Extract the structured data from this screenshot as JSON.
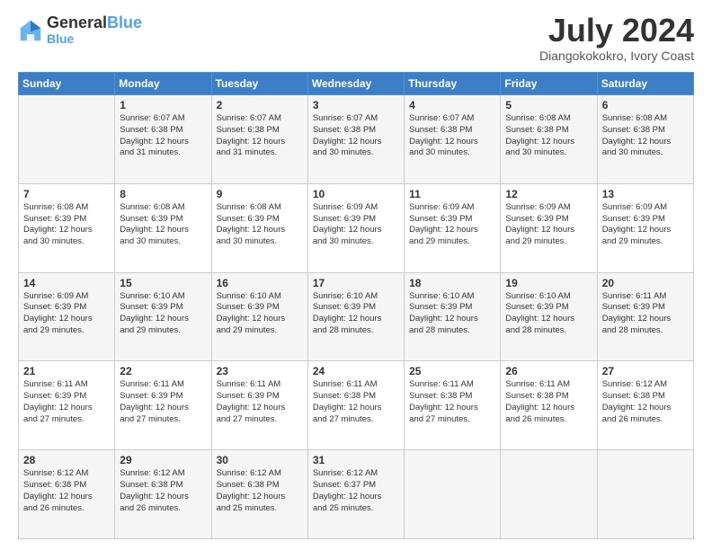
{
  "header": {
    "logo_line1": "General",
    "logo_line2": "Blue",
    "month_year": "July 2024",
    "location": "Diangokokokro, Ivory Coast"
  },
  "weekdays": [
    "Sunday",
    "Monday",
    "Tuesday",
    "Wednesday",
    "Thursday",
    "Friday",
    "Saturday"
  ],
  "weeks": [
    [
      {
        "day": "",
        "info": ""
      },
      {
        "day": "1",
        "info": "Sunrise: 6:07 AM\nSunset: 6:38 PM\nDaylight: 12 hours\nand 31 minutes."
      },
      {
        "day": "2",
        "info": "Sunrise: 6:07 AM\nSunset: 6:38 PM\nDaylight: 12 hours\nand 31 minutes."
      },
      {
        "day": "3",
        "info": "Sunrise: 6:07 AM\nSunset: 6:38 PM\nDaylight: 12 hours\nand 30 minutes."
      },
      {
        "day": "4",
        "info": "Sunrise: 6:07 AM\nSunset: 6:38 PM\nDaylight: 12 hours\nand 30 minutes."
      },
      {
        "day": "5",
        "info": "Sunrise: 6:08 AM\nSunset: 6:38 PM\nDaylight: 12 hours\nand 30 minutes."
      },
      {
        "day": "6",
        "info": "Sunrise: 6:08 AM\nSunset: 6:38 PM\nDaylight: 12 hours\nand 30 minutes."
      }
    ],
    [
      {
        "day": "7",
        "info": "Sunrise: 6:08 AM\nSunset: 6:39 PM\nDaylight: 12 hours\nand 30 minutes."
      },
      {
        "day": "8",
        "info": "Sunrise: 6:08 AM\nSunset: 6:39 PM\nDaylight: 12 hours\nand 30 minutes."
      },
      {
        "day": "9",
        "info": "Sunrise: 6:08 AM\nSunset: 6:39 PM\nDaylight: 12 hours\nand 30 minutes."
      },
      {
        "day": "10",
        "info": "Sunrise: 6:09 AM\nSunset: 6:39 PM\nDaylight: 12 hours\nand 30 minutes."
      },
      {
        "day": "11",
        "info": "Sunrise: 6:09 AM\nSunset: 6:39 PM\nDaylight: 12 hours\nand 29 minutes."
      },
      {
        "day": "12",
        "info": "Sunrise: 6:09 AM\nSunset: 6:39 PM\nDaylight: 12 hours\nand 29 minutes."
      },
      {
        "day": "13",
        "info": "Sunrise: 6:09 AM\nSunset: 6:39 PM\nDaylight: 12 hours\nand 29 minutes."
      }
    ],
    [
      {
        "day": "14",
        "info": "Sunrise: 6:09 AM\nSunset: 6:39 PM\nDaylight: 12 hours\nand 29 minutes."
      },
      {
        "day": "15",
        "info": "Sunrise: 6:10 AM\nSunset: 6:39 PM\nDaylight: 12 hours\nand 29 minutes."
      },
      {
        "day": "16",
        "info": "Sunrise: 6:10 AM\nSunset: 6:39 PM\nDaylight: 12 hours\nand 29 minutes."
      },
      {
        "day": "17",
        "info": "Sunrise: 6:10 AM\nSunset: 6:39 PM\nDaylight: 12 hours\nand 28 minutes."
      },
      {
        "day": "18",
        "info": "Sunrise: 6:10 AM\nSunset: 6:39 PM\nDaylight: 12 hours\nand 28 minutes."
      },
      {
        "day": "19",
        "info": "Sunrise: 6:10 AM\nSunset: 6:39 PM\nDaylight: 12 hours\nand 28 minutes."
      },
      {
        "day": "20",
        "info": "Sunrise: 6:11 AM\nSunset: 6:39 PM\nDaylight: 12 hours\nand 28 minutes."
      }
    ],
    [
      {
        "day": "21",
        "info": "Sunrise: 6:11 AM\nSunset: 6:39 PM\nDaylight: 12 hours\nand 27 minutes."
      },
      {
        "day": "22",
        "info": "Sunrise: 6:11 AM\nSunset: 6:39 PM\nDaylight: 12 hours\nand 27 minutes."
      },
      {
        "day": "23",
        "info": "Sunrise: 6:11 AM\nSunset: 6:39 PM\nDaylight: 12 hours\nand 27 minutes."
      },
      {
        "day": "24",
        "info": "Sunrise: 6:11 AM\nSunset: 6:38 PM\nDaylight: 12 hours\nand 27 minutes."
      },
      {
        "day": "25",
        "info": "Sunrise: 6:11 AM\nSunset: 6:38 PM\nDaylight: 12 hours\nand 27 minutes."
      },
      {
        "day": "26",
        "info": "Sunrise: 6:11 AM\nSunset: 6:38 PM\nDaylight: 12 hours\nand 26 minutes."
      },
      {
        "day": "27",
        "info": "Sunrise: 6:12 AM\nSunset: 6:38 PM\nDaylight: 12 hours\nand 26 minutes."
      }
    ],
    [
      {
        "day": "28",
        "info": "Sunrise: 6:12 AM\nSunset: 6:38 PM\nDaylight: 12 hours\nand 26 minutes."
      },
      {
        "day": "29",
        "info": "Sunrise: 6:12 AM\nSunset: 6:38 PM\nDaylight: 12 hours\nand 26 minutes."
      },
      {
        "day": "30",
        "info": "Sunrise: 6:12 AM\nSunset: 6:38 PM\nDaylight: 12 hours\nand 25 minutes."
      },
      {
        "day": "31",
        "info": "Sunrise: 6:12 AM\nSunset: 6:37 PM\nDaylight: 12 hours\nand 25 minutes."
      },
      {
        "day": "",
        "info": ""
      },
      {
        "day": "",
        "info": ""
      },
      {
        "day": "",
        "info": ""
      }
    ]
  ]
}
